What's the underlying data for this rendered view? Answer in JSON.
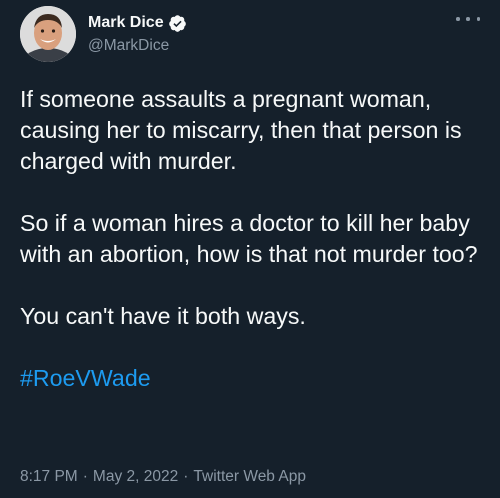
{
  "tweet": {
    "author": {
      "display_name": "Mark Dice",
      "handle": "@MarkDice",
      "verified": true,
      "avatar_icon": "user-avatar"
    },
    "body": {
      "p1": "If someone assaults a pregnant woman, causing her to miscarry, then that person is charged with murder.",
      "p2": "So if a woman hires a doctor to kill her baby with an abortion, how is that not murder too?",
      "p3": "You can't have it both ways.",
      "hashtag": "#RoeVWade"
    },
    "meta": {
      "time": "8:17 PM",
      "separator": "·",
      "date": "May 2, 2022",
      "source": "Twitter Web App"
    },
    "colors": {
      "background": "#15202b",
      "text": "#f7f9f9",
      "secondary_text": "#8b98a5",
      "link": "#1d9bf0",
      "verified_badge": "#f7f9f9"
    },
    "more_icon": "more-horizontal-icon"
  }
}
